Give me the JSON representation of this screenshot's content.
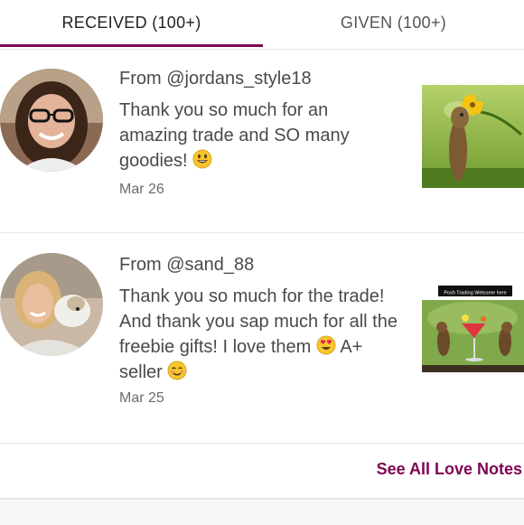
{
  "tabs": {
    "received": "RECEIVED (100+)",
    "given": "GIVEN (100+)"
  },
  "notes": [
    {
      "from": "From @jordans_style18",
      "message_parts": [
        "Thank you so much for an amazing trade and SO many goodies! "
      ],
      "date": "Mar 26"
    },
    {
      "from": "From @sand_88",
      "message_parts": [
        "Thank you so much for the trade! And thank you sap much for all the freebie gifts! I love them ",
        " A+ seller "
      ],
      "date": "Mar 25",
      "thumb_caption": "Posh Trading Welcome here"
    }
  ],
  "footer": {
    "see_all": "See All Love Notes"
  },
  "colors": {
    "accent": "#7f0353",
    "text": "#4a4a4a",
    "date": "#6b6b6b"
  },
  "icons": [
    "smiley-emoji-icon",
    "heart-eyes-emoji-icon",
    "blush-emoji-icon"
  ]
}
